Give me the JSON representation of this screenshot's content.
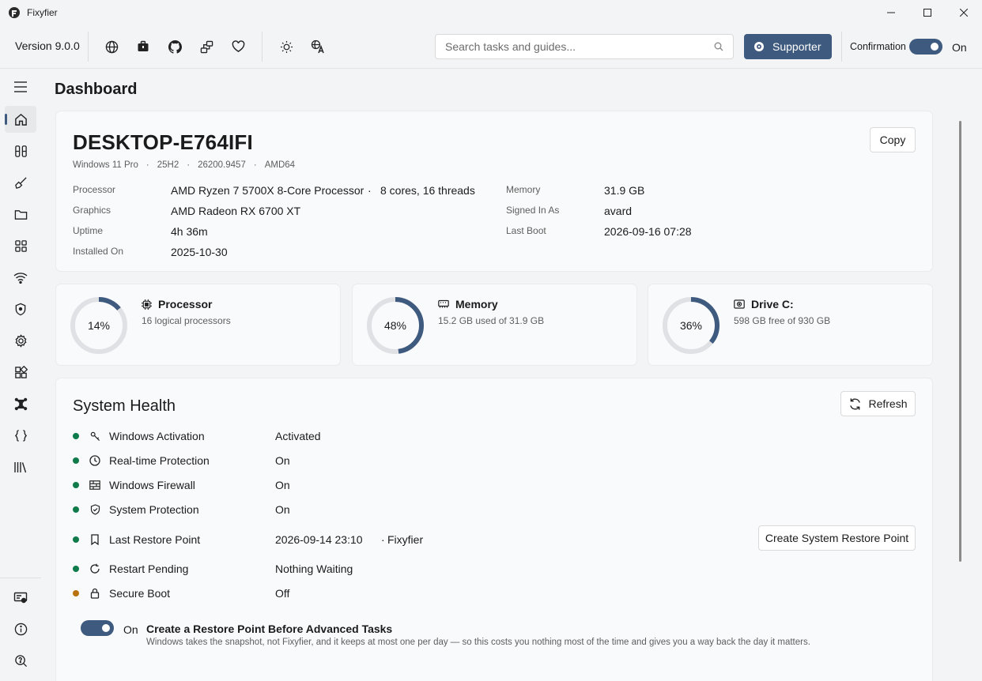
{
  "app": {
    "title": "Fixyfier"
  },
  "toolbar": {
    "version": "Version 9.0.0",
    "icons": [
      "globe-icon",
      "briefcase-icon",
      "github-icon",
      "share-icon",
      "heart-icon",
      "brightness-icon",
      "translate-icon"
    ],
    "search_placeholder": "Search tasks and guides...",
    "supporter_label": "Supporter",
    "confirmation_label": "Confirmation",
    "confirmation_state": "On"
  },
  "sidebar": {
    "items": [
      "menu-icon",
      "home-icon",
      "tools-icon",
      "brush-icon",
      "folder-icon",
      "apps-icon",
      "wifi-icon",
      "shield-icon",
      "settings-icon",
      "widgets-icon",
      "network-icon",
      "braces-icon",
      "library-icon"
    ],
    "bottom": [
      "license-icon",
      "info-icon",
      "help-search-icon"
    ]
  },
  "page": {
    "title": "Dashboard"
  },
  "system": {
    "hostname": "DESKTOP-E764IFI",
    "os": [
      "Windows 11 Pro",
      "25H2",
      "26200.9457",
      "AMD64"
    ],
    "os_separator": "·",
    "copy_label": "Copy",
    "info": {
      "processor_label": "Processor",
      "processor_value": "AMD Ryzen 7 5700X 8-Core Processor",
      "processor_sep": "·",
      "processor_cores": "8 cores, 16 threads",
      "graphics_label": "Graphics",
      "graphics_value": "AMD Radeon RX 6700 XT",
      "uptime_label": "Uptime",
      "uptime_value": "4h 36m",
      "installed_label": "Installed On",
      "installed_value": "2025-10-30",
      "memory_label": "Memory",
      "memory_value": "31.9 GB",
      "signed_label": "Signed In As",
      "signed_value": "avard",
      "lastboot_label": "Last Boot",
      "lastboot_value": "2026-09-16 07:28"
    }
  },
  "resources": [
    {
      "title": "Processor",
      "subtitle": "16 logical processors",
      "percent": 14,
      "percent_text": "14%",
      "icon": "cpu-icon"
    },
    {
      "title": "Memory",
      "subtitle": "15.2 GB used of 31.9 GB",
      "percent": 48,
      "percent_text": "48%",
      "icon": "memory-icon"
    },
    {
      "title": "Drive C:",
      "subtitle": "598 GB free of 930 GB",
      "percent": 36,
      "percent_text": "36%",
      "icon": "drive-icon"
    }
  ],
  "health": {
    "title": "System Health",
    "refresh_label": "Refresh",
    "rows": [
      {
        "name": "Windows Activation",
        "value": "Activated",
        "status": "ok",
        "icon": "key-icon"
      },
      {
        "name": "Real-time Protection",
        "value": "On",
        "status": "ok",
        "icon": "clock-icon"
      },
      {
        "name": "Windows Firewall",
        "value": "On",
        "status": "ok",
        "icon": "firewall-icon"
      },
      {
        "name": "System Protection",
        "value": "On",
        "status": "ok",
        "icon": "shield-check-icon"
      },
      {
        "name": "Last Restore Point",
        "value": "2026-09-14 23:10",
        "value_sep": "·",
        "value_extra": "Fixyfier",
        "status": "ok",
        "icon": "bookmark-icon"
      },
      {
        "name": "Restart Pending",
        "value": "Nothing Waiting",
        "status": "ok",
        "icon": "restart-icon"
      },
      {
        "name": "Secure Boot",
        "value": "Off",
        "status": "warn",
        "icon": "lock-icon"
      }
    ],
    "restore_button": "Create System Restore Point",
    "auto_state": "On",
    "auto_title": "Create a Restore Point Before Advanced Tasks",
    "auto_desc": "Windows takes the snapshot, not Fixyfier, and it keeps at most one per day — so this costs you nothing most of the time and gives you a way back the day it matters."
  },
  "colors": {
    "accent": "#3e5a7e",
    "ok": "#0f7b4a",
    "warn": "#b8720f",
    "track": "#dfe1e4"
  }
}
